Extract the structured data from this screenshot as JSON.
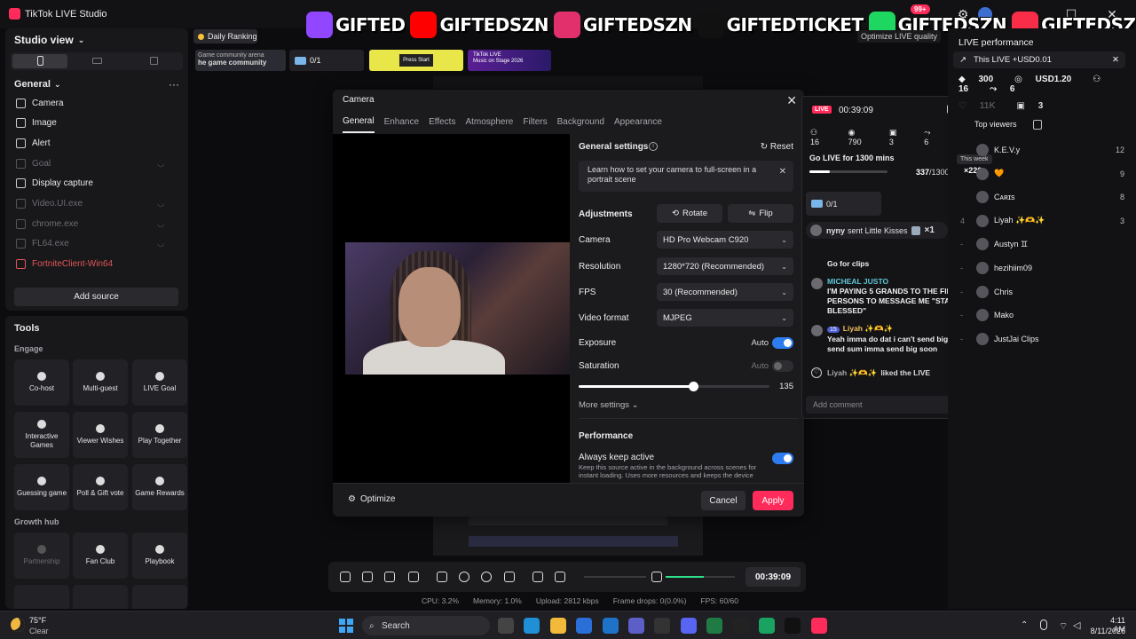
{
  "window": {
    "title": "TikTok LIVE Studio",
    "notification_badge": "99+"
  },
  "banner": {
    "items": [
      {
        "icon": "twitch-icon",
        "text": "GIFTED",
        "color": "#9146ff"
      },
      {
        "icon": "youtube-icon",
        "text": "GIFTEDSZN",
        "color": "#ff0000"
      },
      {
        "icon": "instagram-icon",
        "text": "GIFTEDSZN",
        "color": "#e1306c"
      },
      {
        "icon": "tiktok-icon",
        "text": "GIFTEDTICKET",
        "color": "#111111"
      },
      {
        "icon": "spotify-icon",
        "text": "GIFTEDSZN",
        "color": "#1ed760"
      },
      {
        "icon": "music-icon",
        "text": "GIFTEDSZN",
        "color": "#fa2d48"
      }
    ]
  },
  "sidebar": {
    "studio_view": "Studio view",
    "general": "General",
    "sources": [
      {
        "label": "Camera",
        "state": "normal"
      },
      {
        "label": "Image",
        "state": "normal"
      },
      {
        "label": "Alert",
        "state": "normal"
      },
      {
        "label": "Goal",
        "state": "dim"
      },
      {
        "label": "Display capture",
        "state": "normal"
      },
      {
        "label": "Video.UI.exe",
        "state": "dim"
      },
      {
        "label": "chrome.exe",
        "state": "dim"
      },
      {
        "label": "FL64.exe",
        "state": "dim"
      },
      {
        "label": "FortniteClient-Win64",
        "state": "red"
      }
    ],
    "add_source": "Add source"
  },
  "tools": {
    "title": "Tools",
    "engage": "Engage",
    "growth_hub": "Growth hub",
    "engage_items": [
      "Co-host",
      "Multi-guest",
      "LIVE Goal",
      "Interactive Games",
      "Viewer Wishes",
      "Play Together",
      "Guessing game",
      "Poll & Gift vote",
      "Game Rewards"
    ],
    "growth_items": [
      "Partnership",
      "Fan Club",
      "Playbook"
    ]
  },
  "top": {
    "daily_ranking": "Daily Ranking",
    "thumb1_line1": "Game community arena",
    "thumb1_line2": "he game community",
    "thumb2": "0/1",
    "thumb3": "Press Start",
    "thumb4_line1": "TikTok LIVE",
    "thumb4_line2": "Music on Stage 2026",
    "optimize_quality": "Optimize LIVE quality"
  },
  "camera_dialog": {
    "title": "Camera",
    "tabs": [
      "General",
      "Enhance",
      "Effects",
      "Atmosphere",
      "Filters",
      "Background",
      "Appearance"
    ],
    "general_settings": "General settings",
    "reset": "Reset",
    "tip": "Learn how to set your camera to full-screen in a portrait scene",
    "adjustments": "Adjustments",
    "rotate": "Rotate",
    "flip": "Flip",
    "camera_label": "Camera",
    "camera_value": "HD Pro Webcam C920",
    "resolution_label": "Resolution",
    "resolution_value": "1280*720 (Recommended)",
    "fps_label": "FPS",
    "fps_value": "30 (Recommended)",
    "video_format_label": "Video format",
    "video_format_value": "MJPEG",
    "exposure_label": "Exposure",
    "exposure_auto": "Auto",
    "saturation_label": "Saturation",
    "saturation_auto": "Auto",
    "saturation_value": "135",
    "saturation_level": 0.6,
    "more_settings": "More settings",
    "performance": "Performance",
    "always_keep_active": "Always keep active",
    "always_keep_desc": "Keep this source active in the background across scenes for instant loading. Uses more resources and keeps the device",
    "optimize": "Optimize",
    "cancel": "Cancel",
    "apply": "Apply"
  },
  "live_panel": {
    "live": "LIVE",
    "time": "00:39:09",
    "stats": [
      "16",
      "790",
      "3",
      "6",
      "11 K"
    ],
    "goal_title": "Go LIVE for 1300 mins",
    "goal_current": "337",
    "goal_total": "/1300",
    "goal_progress": 0.26,
    "gift_chip": "0/1",
    "kiss_user": "nyny",
    "kiss_text": "sent Little Kisses",
    "kiss_count": "×1",
    "messages": [
      {
        "name": "",
        "text": "Go for clips"
      },
      {
        "name": "MICHEAL JUSTO",
        "text": "I'M PAYING 5 GRANDS TO THE FIRST 5 PERSONS TO MESSAGE ME \"STAY BLESSED\""
      },
      {
        "name": "Liyah ✨🫶✨",
        "level": "15",
        "text": "Yeah imma do dat i can't send big but i can send sum imma send big soon"
      }
    ],
    "liked_user": "Liyah ✨🫶✨",
    "liked_text": "liked the LIVE",
    "comment_placeholder": "Add comment"
  },
  "right_panel": {
    "title": "LIVE performance",
    "this_live": "This LIVE +USD0.01",
    "stats": [
      "300",
      "USD1.20",
      "16",
      "6",
      "11K",
      "3"
    ],
    "top_viewers": "Top viewers",
    "this_week": "This week",
    "week_count": "×220",
    "viewers": [
      {
        "rank": "",
        "name": "K.E.V.y",
        "score": "12"
      },
      {
        "rank": "",
        "name": "🧡",
        "score": "9"
      },
      {
        "rank": "",
        "name": "Cᴀʀɪs",
        "score": "8"
      },
      {
        "rank": "4",
        "name": "Liyah ✨🫶✨",
        "score": "3"
      },
      {
        "rank": "-",
        "name": "Austyn ♊",
        "score": ""
      },
      {
        "rank": "-",
        "name": "hezihiim09",
        "score": ""
      },
      {
        "rank": "-",
        "name": "Chris",
        "score": ""
      },
      {
        "rank": "-",
        "name": "Mako",
        "score": ""
      },
      {
        "rank": "-",
        "name": "JustJai Clips",
        "score": ""
      }
    ]
  },
  "control_bar": {
    "timer": "00:39:09",
    "mic_level": 0.55
  },
  "status_line": {
    "cpu": "CPU: 3.2%",
    "memory": "Memory: 1.0%",
    "upload": "Upload: 2812 kbps",
    "frame_drops": "Frame drops: 0(0.0%)",
    "fps": "FPS: 60/60"
  },
  "taskbar": {
    "temp": "75°F",
    "weather": "Clear",
    "search": "Search",
    "time": "4:11 AM",
    "date": "8/11/2026"
  }
}
